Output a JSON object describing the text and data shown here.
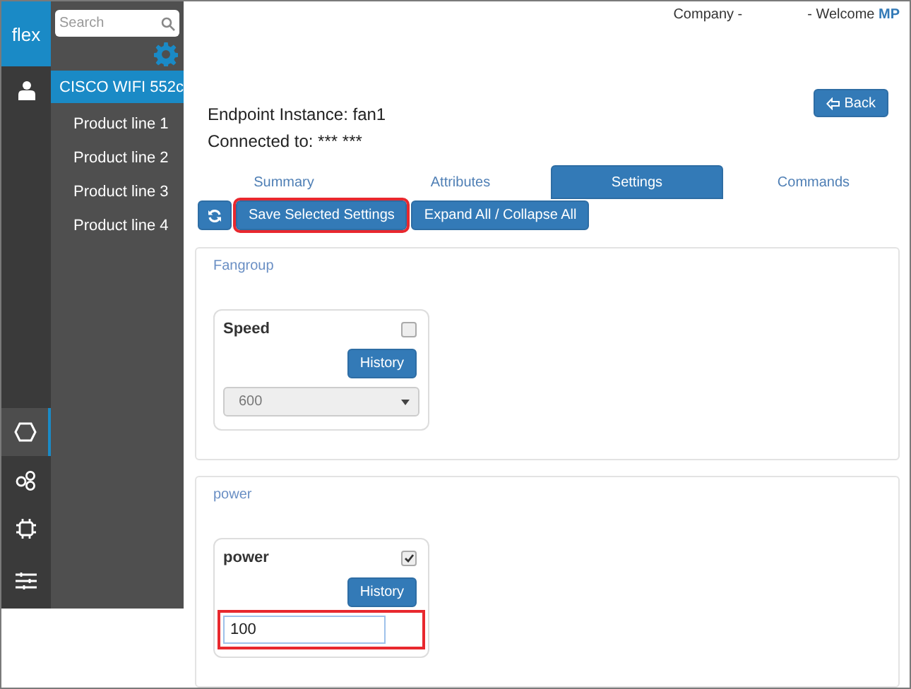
{
  "header": {
    "company": "Company -",
    "welcome": "- Welcome",
    "user": "MP"
  },
  "rail": {
    "logo": "flex",
    "items": [
      {
        "kind": "user",
        "selected": false
      },
      {
        "kind": "hexagon",
        "selected": true
      },
      {
        "kind": "circles",
        "selected": false
      },
      {
        "kind": "chip",
        "selected": false
      },
      {
        "kind": "sliders",
        "selected": false
      }
    ]
  },
  "nav": {
    "search": {
      "placeholder": "Search"
    },
    "items": [
      {
        "label": "CISCO WIFI 552c",
        "selected": true
      },
      {
        "label": "Product line 1",
        "selected": false
      },
      {
        "label": "Product line 2",
        "selected": false
      },
      {
        "label": "Product line 3",
        "selected": false
      },
      {
        "label": "Product line 4",
        "selected": false
      }
    ]
  },
  "endpoint": {
    "instance": "Endpoint Instance: fan1",
    "connected": "Connected to: *** ***",
    "back": "Back"
  },
  "tabs": [
    {
      "label": "Summary",
      "selected": false
    },
    {
      "label": "Attributes",
      "selected": false
    },
    {
      "label": "Settings",
      "selected": true
    },
    {
      "label": "Commands",
      "selected": false
    }
  ],
  "toolbar": {
    "save": {
      "label": "Save Selected Settings",
      "highlighted": true
    },
    "expand": {
      "label": "Expand All / Collapse All",
      "highlighted": false
    }
  },
  "groups": [
    {
      "title": "Fangroup",
      "setting": {
        "name": "Speed",
        "checked": false,
        "history": "History",
        "kind": "select",
        "value": "600",
        "disabled": true,
        "highlighted": false
      }
    },
    {
      "title": "power",
      "setting": {
        "name": "power",
        "checked": true,
        "history": "History",
        "kind": "input",
        "value": "100",
        "disabled": false,
        "highlighted": true
      }
    }
  ]
}
